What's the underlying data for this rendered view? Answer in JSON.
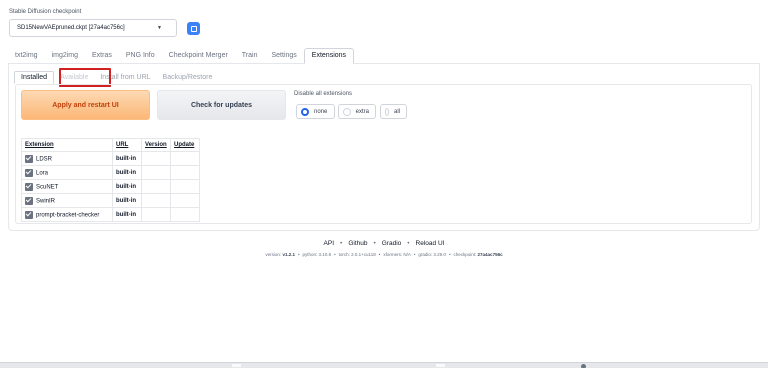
{
  "checkpoint": {
    "label": "Stable Diffusion checkpoint",
    "value": "SD15NewVAEpruned.ckpt [27a4ac756c]"
  },
  "main_tabs": [
    "txt2img",
    "img2img",
    "Extras",
    "PNG Info",
    "Checkpoint Merger",
    "Train",
    "Settings",
    "Extensions"
  ],
  "sub_tabs": [
    "Installed",
    "Available",
    "Install from URL",
    "Backup/Restore"
  ],
  "buttons": {
    "apply": "Apply and restart UI",
    "check": "Check for updates"
  },
  "disable": {
    "label": "Disable all extensions",
    "options": [
      "none",
      "extra",
      "all"
    ],
    "selected": "none"
  },
  "table": {
    "headers": [
      "Extension",
      "URL",
      "Version",
      "Update"
    ],
    "rows": [
      {
        "name": "LDSR",
        "url": "built-in",
        "version": "",
        "update": "",
        "checked": true
      },
      {
        "name": "Lora",
        "url": "built-in",
        "version": "",
        "update": "",
        "checked": true
      },
      {
        "name": "ScuNET",
        "url": "built-in",
        "version": "",
        "update": "",
        "checked": true
      },
      {
        "name": "SwinIR",
        "url": "built-in",
        "version": "",
        "update": "",
        "checked": true
      },
      {
        "name": "prompt-bracket-checker",
        "url": "built-in",
        "version": "",
        "update": "",
        "checked": true
      }
    ]
  },
  "footer": {
    "links": [
      "API",
      "Github",
      "Gradio",
      "Reload UI"
    ],
    "version_label": "version:",
    "version": "v1.2.1",
    "python": "python: 3.10.6",
    "torch": "torch: 2.0.1+cu118",
    "xformers": "xformers: N/A",
    "gradio": "gradio: 3.29.0",
    "checkpoint_label": "checkpoint:",
    "checkpoint": "27a4ac756c"
  },
  "colors": {
    "accent_blue": "#3b82f6",
    "primary_orange": "#fcb776",
    "highlight_red": "#d21f1f"
  }
}
